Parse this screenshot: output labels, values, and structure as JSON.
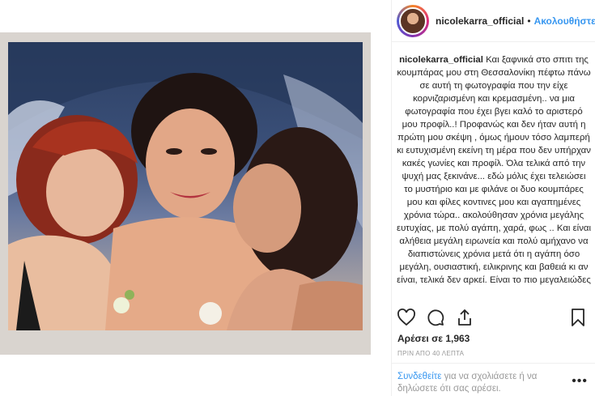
{
  "header": {
    "username": "nicolekarra_official",
    "separator": "•",
    "follow_label": "Ακολουθήστε"
  },
  "caption": {
    "username": "nicolekarra_official",
    "text": "Και ξαφνικά στο σπιτι της κουμπάρας μου στη Θεσσαλονίκη πέφτω πάνω σε αυτή τη φωτογραφία που την είχε κορνιζαρισμένη και κρεμασμένη.. να μια φωτογραφία που έχει βγει καλό το αριστερό μου προφίλ..! Προφανώς και δεν ήταν αυτή η πρώτη μου σκέψη , όμως ήμουν τόσο λαμπερή κι ευτυχισμένη εκείνη τη μέρα που δεν υπήρχαν κακές γωνίες και προφίλ. Όλα τελικά από την ψυχή μας ξεκινάνε... εδώ μόλις έχει τελειώσει το μυστήριο και με φιλάνε οι δυο κουμπάρες μου και φίλες κοντινες μου και αγαπημένες χρόνια τώρα.. ακολούθησαν χρόνια μεγάλης ευτυχίας, με πολύ αγάπη, χαρά, φως .. Και είναι αλήθεια μεγάλη ειρωνεία και πολύ αμήχανο να διαπιστώνεις χρόνια μετά ότι η αγάπη όσο μεγάλη, ουσιαστική, ειλικρινης και βαθειά κι αν είναι, τελικά δεν αρκεί. Είναι το πιο μεγαλειώδες"
  },
  "actions": {
    "like_icon": "heart-icon",
    "comment_icon": "comment-bubble-icon",
    "share_icon": "share-icon",
    "save_icon": "bookmark-icon"
  },
  "likes_text": "Αρέσει σε 1,963",
  "timestamp": "ΠΡΙΝ ΑΠΟ 40 ΛΕΠΤΑ",
  "comment": {
    "login_link": "Συνδεθείτε",
    "prompt": " για να σχολιάσετε ή να δηλώσετε ότι σας αρέσει.",
    "more_label": "•••"
  },
  "colors": {
    "link_blue": "#3897f0",
    "text": "#262626",
    "muted": "#999999",
    "divider": "#efefef"
  }
}
